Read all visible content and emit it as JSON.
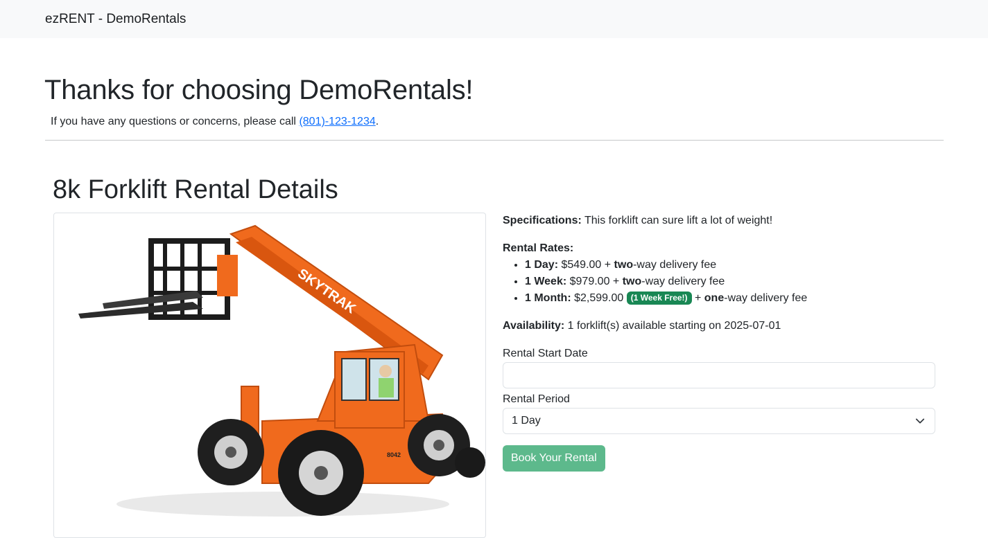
{
  "navbar": {
    "brand": "ezRENT - DemoRentals"
  },
  "welcome": {
    "title": "Thanks for choosing DemoRentals!",
    "subtitle_prefix": "If you have any questions or concerns, please call ",
    "phone": "(801)-123-1234",
    "subtitle_suffix": "."
  },
  "details": {
    "title": "8k Forklift Rental Details",
    "image_brand_text": "SKYTRAK",
    "image_model_text": "8042",
    "specifications_label": "Specifications:",
    "specifications_text": " This forklift can sure lift a lot of weight!",
    "rental_rates_label": "Rental Rates:",
    "rates": [
      {
        "period": "1 Day:",
        "price": " $549.00 + ",
        "trip": "two",
        "suffix": "-way delivery fee",
        "badge": ""
      },
      {
        "period": "1 Week:",
        "price": " $979.00 + ",
        "trip": "two",
        "suffix": "-way delivery fee",
        "badge": ""
      },
      {
        "period": "1 Month:",
        "price": " $2,599.00 ",
        "trip": "one",
        "suffix": "-way delivery fee",
        "badge": "(1 Week Free!)"
      }
    ],
    "availability_label": "Availability:",
    "availability_text": " 1 forklift(s) available starting on 2025-07-01"
  },
  "form": {
    "start_date_label": "Rental Start Date",
    "start_date_value": "",
    "period_label": "Rental Period",
    "period_selected": "1 Day",
    "submit_label": "Book Your Rental"
  },
  "colors": {
    "link": "#0d6efd",
    "badge": "#198754",
    "button": "#5db98c",
    "forklift_orange": "#f06a1d"
  }
}
